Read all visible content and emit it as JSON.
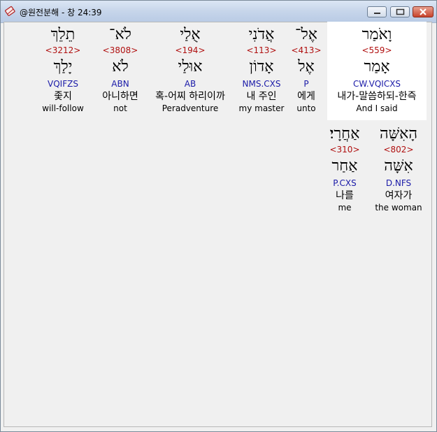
{
  "window": {
    "title": "@원전분해 - 창 24:39"
  },
  "icons": {
    "app": "bible-app-icon",
    "minimize": "minimize-icon",
    "maximize": "maximize-icon",
    "close": "close-icon"
  },
  "colors": {
    "strong": "#b01010",
    "morph": "#1a1aa8",
    "highlight": "#ffffff"
  },
  "row1": [
    {
      "hebrew": "וָאֹמַר",
      "strong": "<559>",
      "lemma": "אָמַר",
      "morph": "CW.VQICXS",
      "korean": "내가-말씀하되-한즉",
      "english": "And I said",
      "selected": true
    },
    {
      "hebrew": "אֶל־",
      "strong": "<413>",
      "lemma": "אֶל",
      "morph": "P",
      "korean": "에게",
      "english": "unto"
    },
    {
      "hebrew": "אֲדֹנִי",
      "strong": "<113>",
      "lemma": "אָדוֹן",
      "morph": "NMS.CXS",
      "korean": "내 주인",
      "english": "my master"
    },
    {
      "hebrew": "אֻלַי",
      "strong": "<194>",
      "lemma": "אוּלַי",
      "morph": "AB",
      "korean": "혹-어찌 하리이까",
      "english": "Peradventure"
    },
    {
      "hebrew": "לֹא־",
      "strong": "<3808>",
      "lemma": "לֹא",
      "morph": "ABN",
      "korean": "아니하면",
      "english": "not"
    },
    {
      "hebrew": "תֵלֵךְ",
      "strong": "<3212>",
      "lemma": "יָלַךְ",
      "morph": "VQIFZS",
      "korean": "좇지",
      "english": "will-follow"
    }
  ],
  "row2": [
    {
      "hebrew": "הָאִשָּׁה",
      "strong": "<802>",
      "lemma": "אִשָּׁה",
      "morph": "D.NFS",
      "korean": "여자가",
      "english": "the woman"
    },
    {
      "hebrew": "אַחֲרָי׃",
      "strong": "<310>",
      "lemma": "אַחַר",
      "morph": "P.CXS",
      "korean": "나를",
      "english": "me"
    }
  ]
}
